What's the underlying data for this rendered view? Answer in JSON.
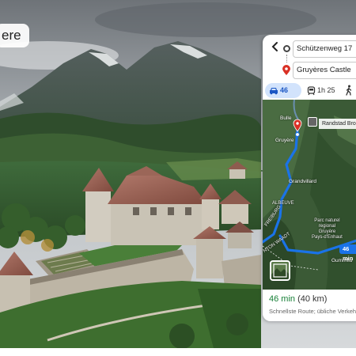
{
  "overlay": {
    "label": "ere"
  },
  "directions": {
    "origin": "Schützenweg 17",
    "destination": "Gruyères Castle"
  },
  "modes": {
    "car_label": "46 min",
    "transit_label": "1h 25"
  },
  "map": {
    "poi_label": "Randstad Bro",
    "route_time": "46 min",
    "places": {
      "bulle": "Bulle",
      "gruyere": "Gruyère",
      "grandvillard": "Grandvillard",
      "albeuve": "ALBEUVE",
      "freiburg": "FREIBURG",
      "waadt": "NTON WAADT",
      "park": "Parc naturel\nregional\nGruyère\nPays-d'Enhaut",
      "gummfluh": "Gummflu"
    },
    "colors": {
      "route": "#1a73e8",
      "destination_pin": "#d93025"
    }
  },
  "summary": {
    "time": "46 min",
    "distance": "(40 km)",
    "note": "Schnellste Route; übliche Verkeh"
  },
  "icons": {
    "back": "arrow-left",
    "car": "car",
    "transit": "train",
    "walk": "walking-person",
    "origin": "origin-circle",
    "destination": "location-pin"
  }
}
